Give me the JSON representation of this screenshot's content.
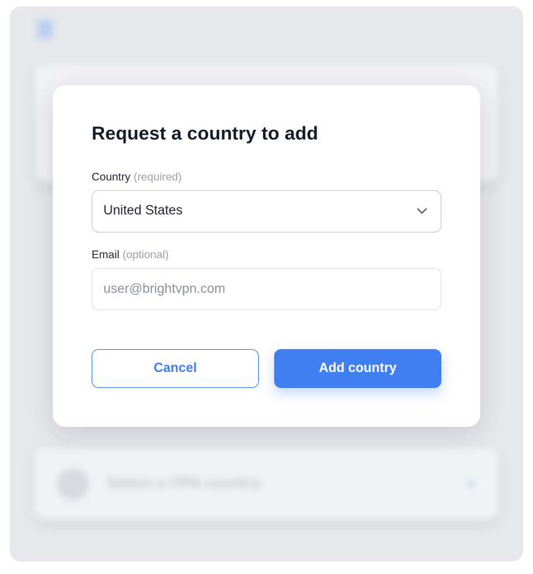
{
  "background": {
    "select_label": "Select a VPN country",
    "icons": [
      "menu-icon",
      "globe-icon",
      "chevron-down-icon"
    ]
  },
  "modal": {
    "title": "Request a country to add",
    "country": {
      "label": "Country",
      "hint": "(required)",
      "value": "United States",
      "icon": "chevron-down-icon"
    },
    "email": {
      "label": "Email",
      "hint": "(optional)",
      "value": "",
      "placeholder": "user@brightvpn.com"
    },
    "buttons": {
      "cancel_label": "Cancel",
      "add_label": "Add country"
    }
  },
  "colors": {
    "accent": "#3f7ff2",
    "title_text": "#141c2b",
    "hint_text": "#9aa1ac",
    "backdrop": "#e6e8eb"
  }
}
